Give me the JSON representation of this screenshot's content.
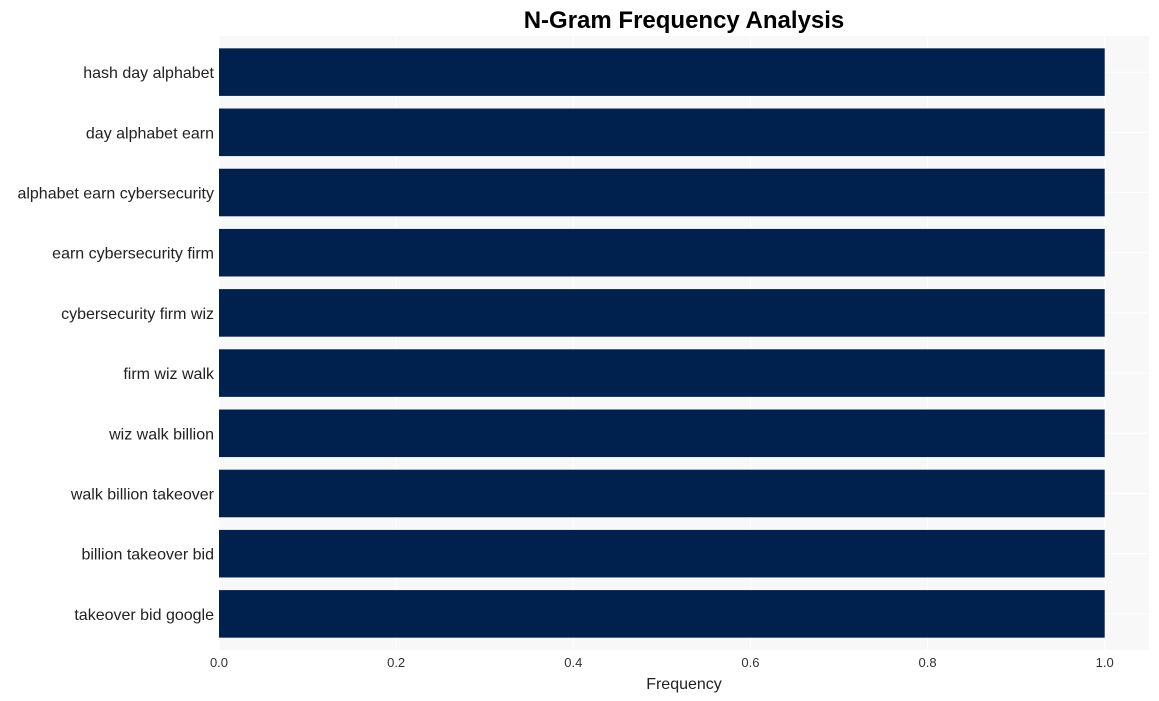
{
  "chart_data": {
    "type": "bar",
    "orientation": "horizontal",
    "title": "N-Gram Frequency Analysis",
    "xlabel": "Frequency",
    "ylabel": "",
    "categories": [
      "hash day alphabet",
      "day alphabet earn",
      "alphabet earn cybersecurity",
      "earn cybersecurity firm",
      "cybersecurity firm wiz",
      "firm wiz walk",
      "wiz walk billion",
      "walk billion takeover",
      "billion takeover bid",
      "takeover bid google"
    ],
    "values": [
      1,
      1,
      1,
      1,
      1,
      1,
      1,
      1,
      1,
      1
    ],
    "xlim": [
      0,
      1.05
    ],
    "xticks": [
      "0.0",
      "0.2",
      "0.4",
      "0.6",
      "0.8",
      "1.0"
    ],
    "grid": true,
    "bar_color": "#00204e",
    "plot_background": "#f8f8f8",
    "grid_color": "#ffffff"
  }
}
